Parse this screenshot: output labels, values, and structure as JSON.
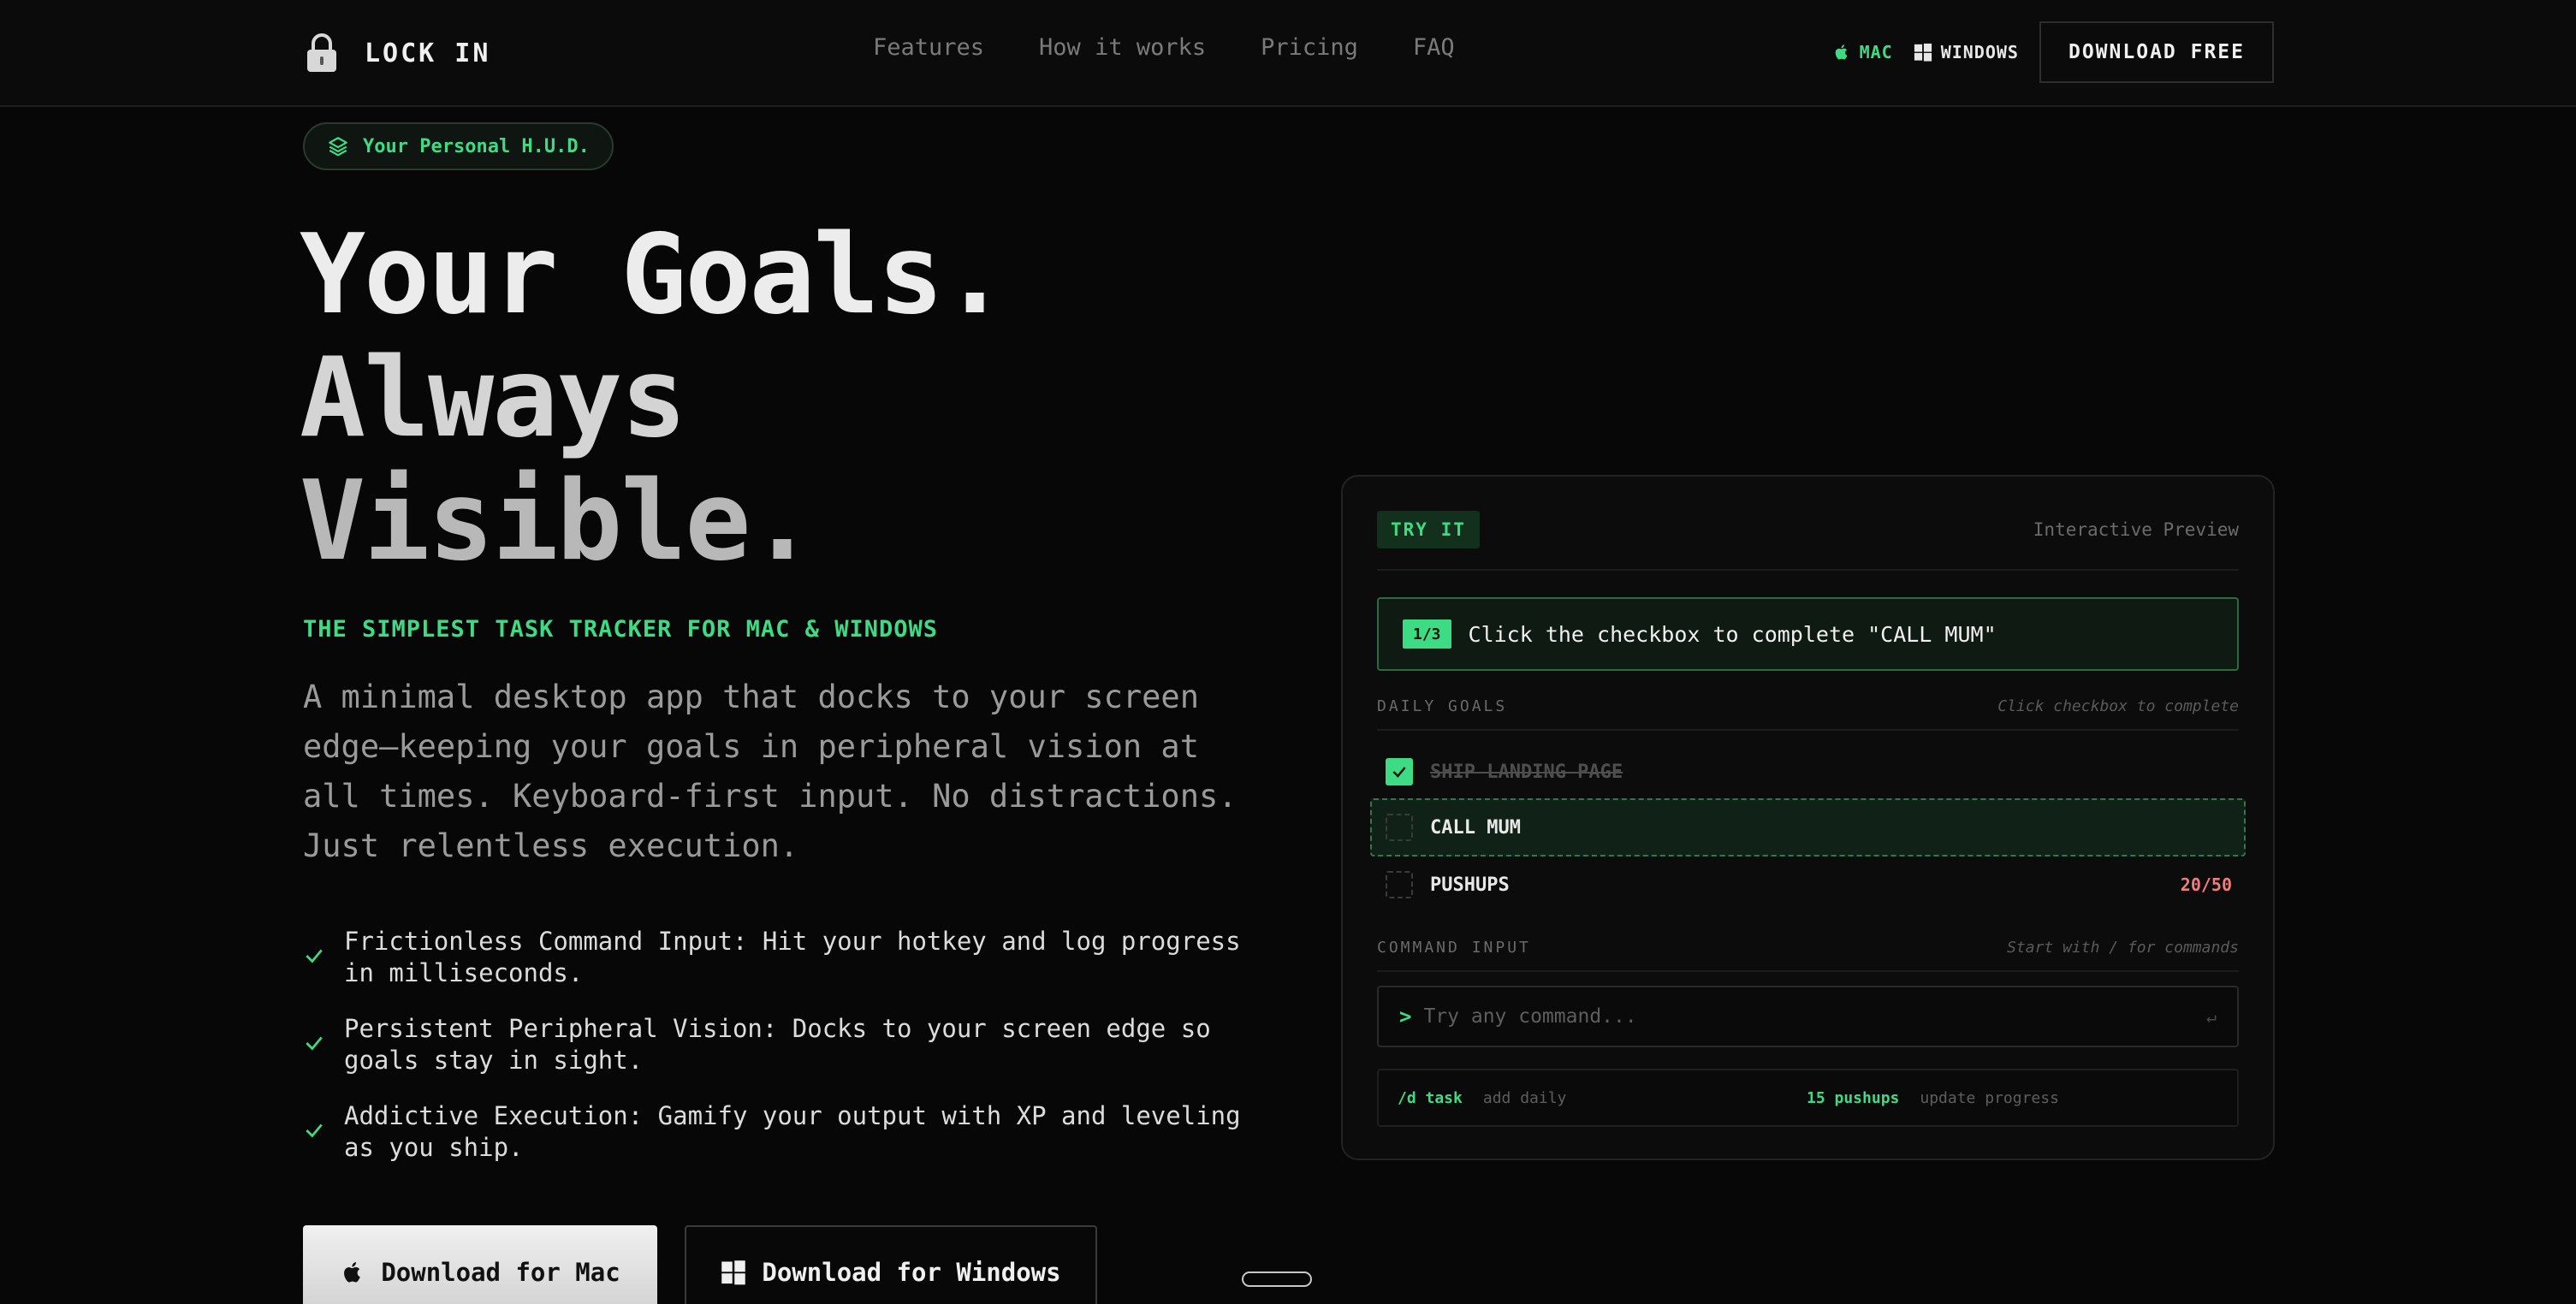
{
  "nav": {
    "brand": "LOCK IN",
    "links": [
      "Features",
      "How it works",
      "Pricing",
      "FAQ"
    ],
    "platform_mac": "MAC",
    "platform_windows": "WINDOWS",
    "download_label": "DOWNLOAD FREE"
  },
  "hero": {
    "badge": "Your Personal H.U.D.",
    "headline": [
      "Your Goals.",
      "Always",
      "Visible."
    ],
    "tagline": "THE SIMPLEST TASK TRACKER FOR MAC & WINDOWS",
    "description": "A minimal desktop app that docks to your screen edge—keeping your goals in peripheral vision at all times. Keyboard-first input. No distractions. Just relentless execution.",
    "features": [
      "Frictionless Command Input: Hit your hotkey and log progress in milliseconds.",
      "Persistent Peripheral Vision: Docks to your screen edge so goals stay in sight.",
      "Addictive Execution: Gamify your output with XP and leveling as you ship."
    ],
    "btn_mac": "Download for Mac",
    "btn_windows": "Download for Windows"
  },
  "preview": {
    "try_it": "TRY IT",
    "label": "Interactive Preview",
    "step": "1/3",
    "hint": "Click the checkbox to complete \"CALL MUM\"",
    "daily_goals_title": "DAILY GOALS",
    "daily_goals_note": "Click checkbox to complete",
    "goals": [
      {
        "label": "SHIP LANDING PAGE",
        "done": true,
        "count": ""
      },
      {
        "label": "CALL MUM",
        "done": false,
        "count": ""
      },
      {
        "label": "PUSHUPS",
        "done": false,
        "count": "20/50"
      }
    ],
    "command_title": "COMMAND INPUT",
    "command_note": "Start with / for commands",
    "prompt": ">",
    "placeholder": "Try any command...",
    "enter_glyph": "↵",
    "examples": [
      {
        "cmd": "/d task",
        "desc": "add daily"
      },
      {
        "cmd": "15 pushups",
        "desc": "update progress"
      }
    ]
  },
  "colors": {
    "accent": "#3ddc84",
    "background": "#070707",
    "warning": "#f07c7c"
  }
}
